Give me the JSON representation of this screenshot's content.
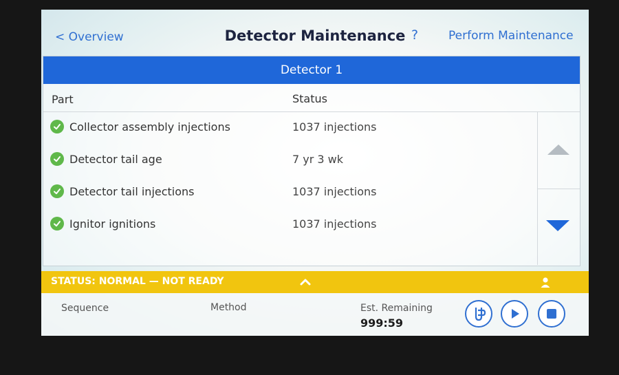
{
  "header": {
    "back_label": "< Overview",
    "title": "Detector Maintenance",
    "help_label": "?",
    "perform_label": "Perform Maintenance"
  },
  "panel": {
    "title": "Detector 1",
    "columns": {
      "part": "Part",
      "status": "Status"
    },
    "rows": [
      {
        "part": "Collector assembly injections",
        "status": "1037 injections",
        "state": "ok"
      },
      {
        "part": "Detector tail age",
        "status": "7 yr 3 wk",
        "state": "ok"
      },
      {
        "part": "Detector tail injections",
        "status": "1037 injections",
        "state": "ok"
      },
      {
        "part": "Ignitor ignitions",
        "status": "1037 injections",
        "state": "ok"
      }
    ]
  },
  "status_bar": {
    "text": "STATUS: NORMAL — NOT READY",
    "color": "#f1c50f"
  },
  "bottom": {
    "sequence_label": "Sequence",
    "method_label": "Method",
    "remaining_label": "Est. Remaining",
    "remaining_value": "999:59"
  },
  "colors": {
    "accent": "#2f6fd1",
    "header_blue": "#1f67d9",
    "ok_green": "#5fb84a"
  },
  "icons": [
    "check-icon",
    "scroll-up-icon",
    "scroll-down-icon",
    "expand-up-icon",
    "user-icon",
    "sampler-icon",
    "play-icon",
    "stop-icon"
  ]
}
